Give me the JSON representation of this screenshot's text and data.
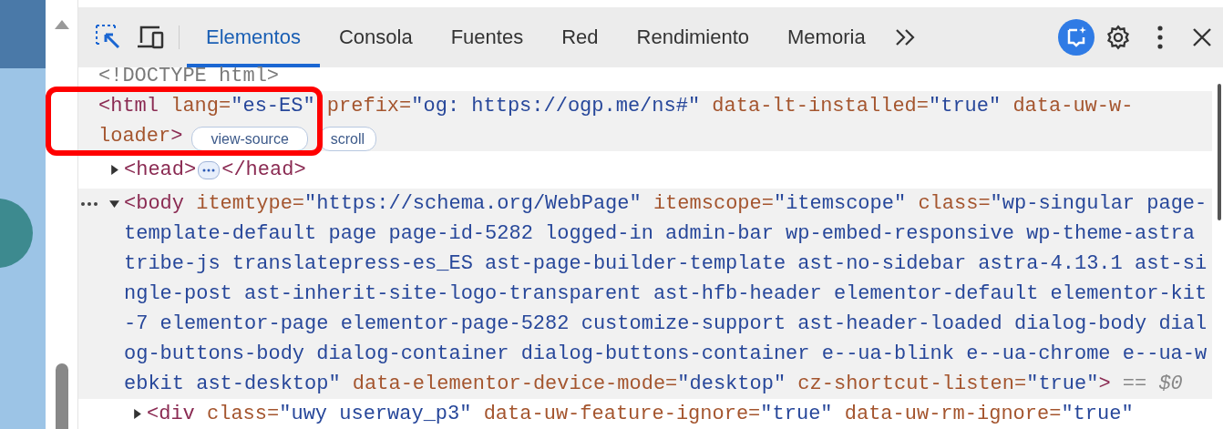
{
  "toolbar": {
    "tabs": [
      {
        "label": "Elementos",
        "selected": true
      },
      {
        "label": "Consola",
        "selected": false
      },
      {
        "label": "Fuentes",
        "selected": false
      },
      {
        "label": "Red",
        "selected": false
      },
      {
        "label": "Rendimiento",
        "selected": false
      },
      {
        "label": "Memoria",
        "selected": false
      }
    ]
  },
  "nodes": [
    {
      "kind": "doctype",
      "selected": false,
      "hovered": false,
      "lines": [
        [
          {
            "kind": "doctype",
            "s": "<!DOCTYPE html>"
          }
        ]
      ]
    },
    {
      "kind": "element",
      "selected": false,
      "hovered": true,
      "badges": [
        "view-source",
        "scroll"
      ],
      "lines": [
        [
          {
            "kind": "tag",
            "s": "<html"
          },
          {
            "kind": "attr",
            "s": " lang="
          },
          {
            "kind": "value",
            "s": "\"es-ES\""
          },
          {
            "kind": "attr",
            "s": " prefix="
          },
          {
            "kind": "value",
            "s": "\"og: https://ogp.me/ns#\""
          },
          {
            "kind": "attr",
            "s": " data-lt-installed="
          },
          {
            "kind": "value",
            "s": "\"true\""
          },
          {
            "kind": "attr",
            "s": " data-uw-w-"
          }
        ],
        [
          {
            "kind": "attr",
            "s": "loader"
          },
          {
            "kind": "tag",
            "s": ">"
          }
        ]
      ]
    },
    {
      "kind": "element",
      "selected": false,
      "hovered": false,
      "expanded": false,
      "lines": [
        [
          {
            "kind": "tag",
            "s": "<head>"
          },
          {
            "kind": "chip"
          },
          {
            "kind": "tag",
            "s": "</head>"
          }
        ]
      ]
    },
    {
      "kind": "element",
      "selected": true,
      "hovered": false,
      "expanded": true,
      "lines": [
        [
          {
            "kind": "tag",
            "s": "<body"
          },
          {
            "kind": "attr",
            "s": " itemtype="
          },
          {
            "kind": "value",
            "s": "\"https://schema.org/WebPage\""
          },
          {
            "kind": "attr",
            "s": " itemscope="
          },
          {
            "kind": "value",
            "s": "\"itemscope\""
          },
          {
            "kind": "attr",
            "s": " class="
          },
          {
            "kind": "value",
            "s": "\"wp-singular page-"
          }
        ],
        [
          {
            "kind": "value",
            "s": "template-default page page-id-5282 logged-in admin-bar wp-embed-responsive wp-theme-astra"
          }
        ],
        [
          {
            "kind": "value",
            "s": "tribe-js translatepress-es_ES ast-page-builder-template ast-no-sidebar astra-4.13.1 ast-si"
          }
        ],
        [
          {
            "kind": "value",
            "s": "ngle-post ast-inherit-site-logo-transparent ast-hfb-header elementor-default elementor-kit"
          }
        ],
        [
          {
            "kind": "value",
            "s": "-7 elementor-page elementor-page-5282 customize-support ast-header-loaded dialog-body dial"
          }
        ],
        [
          {
            "kind": "value",
            "s": "og-buttons-body dialog-container dialog-buttons-container e--ua-blink e--ua-chrome e--ua-w"
          }
        ],
        [
          {
            "kind": "value",
            "s": "ebkit ast-desktop\""
          },
          {
            "kind": "attr",
            "s": " data-elementor-device-mode="
          },
          {
            "kind": "value",
            "s": "\"desktop\""
          },
          {
            "kind": "attr",
            "s": " cz-shortcut-listen="
          },
          {
            "kind": "value",
            "s": "\"true\""
          },
          {
            "kind": "tag",
            "s": ">"
          },
          {
            "kind": "hint",
            "s": " == $0"
          }
        ]
      ]
    },
    {
      "kind": "child",
      "selected": false,
      "hovered": false,
      "expanded": false,
      "lines": [
        [
          {
            "kind": "tag",
            "s": "<div"
          },
          {
            "kind": "attr",
            "s": " class="
          },
          {
            "kind": "value",
            "s": "\"uwy userway_p3\""
          },
          {
            "kind": "attr",
            "s": " data-uw-feature-ignore="
          },
          {
            "kind": "value",
            "s": "\"true\""
          },
          {
            "kind": "attr",
            "s": " data-uw-rm-ignore="
          },
          {
            "kind": "value",
            "s": "\"true\""
          }
        ]
      ]
    }
  ]
}
